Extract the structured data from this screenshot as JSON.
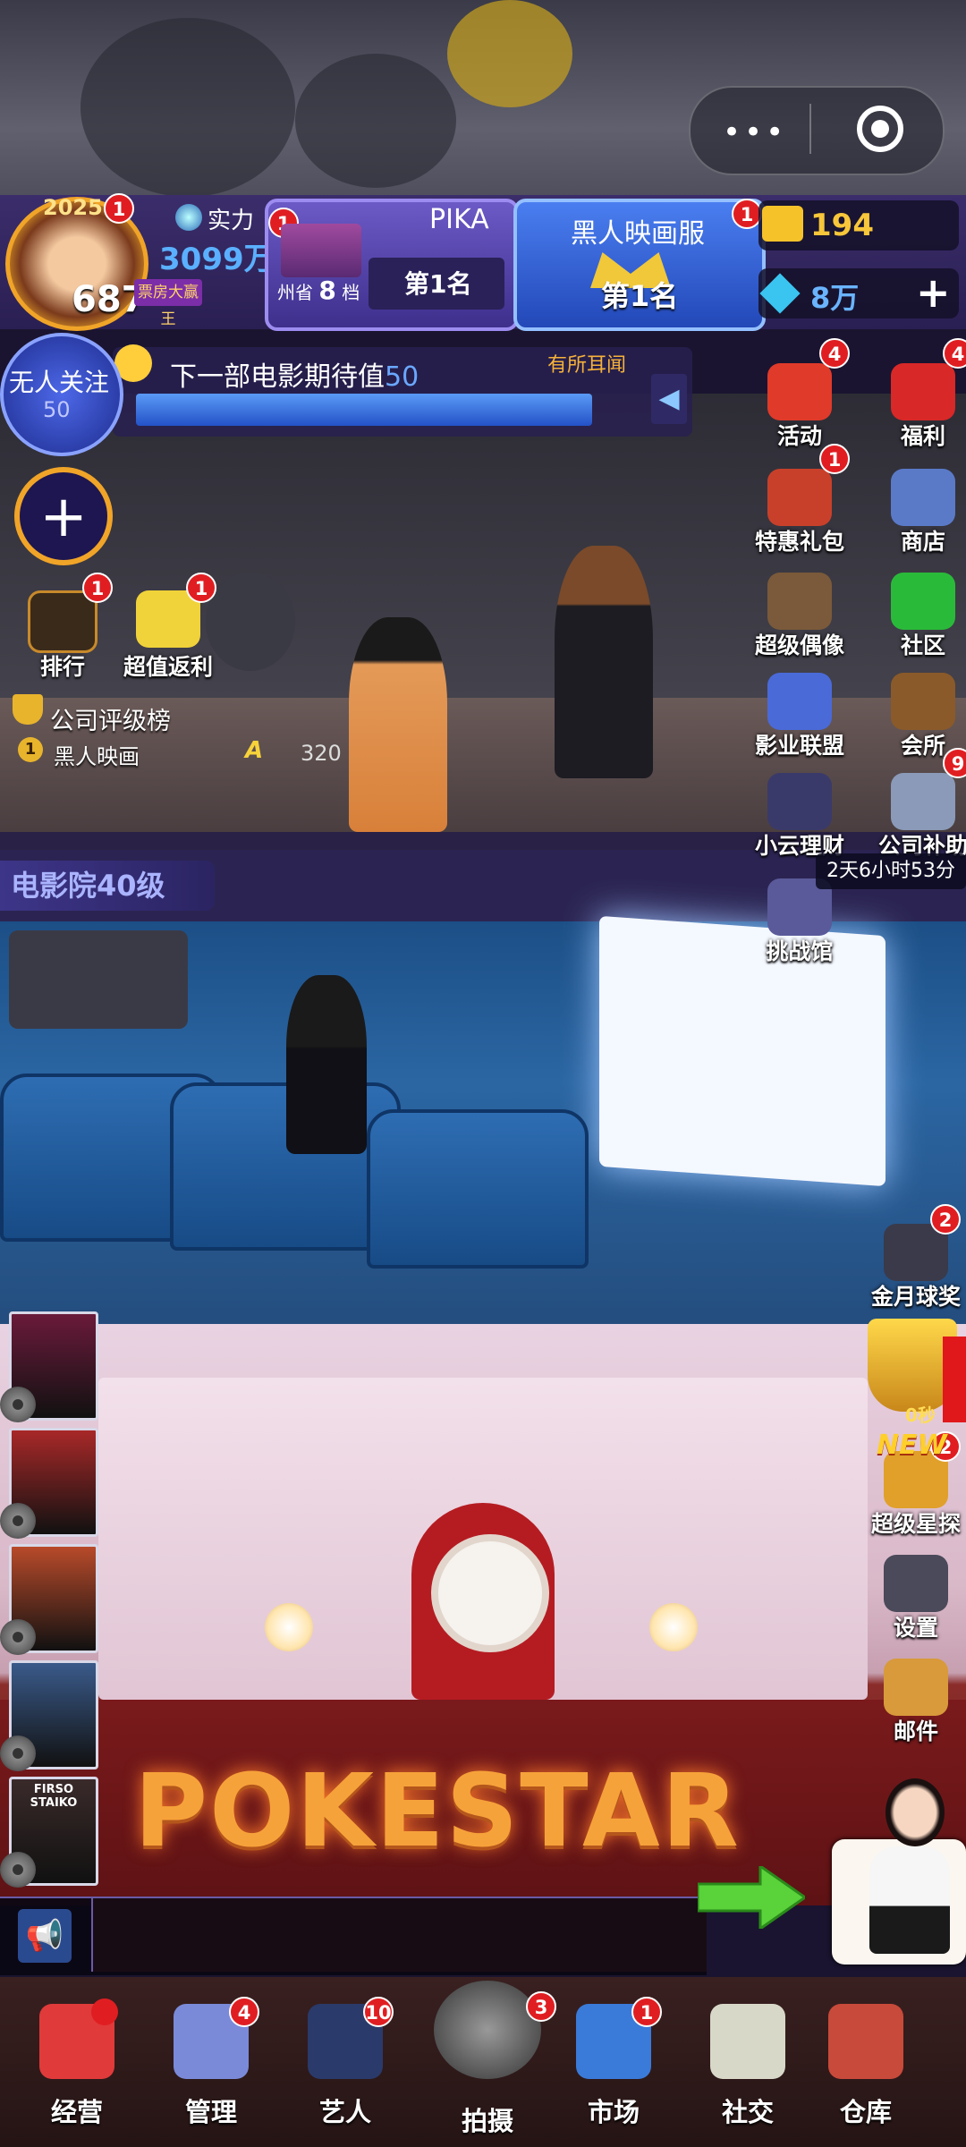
{
  "top_pill": {
    "more_label": "•••",
    "target_label": "◎"
  },
  "player": {
    "year": "2025",
    "level": "687",
    "crown_title": "票房大赢王",
    "power_label": "实力",
    "power_value": "3099万",
    "avatar_badge": "1"
  },
  "rank_card": {
    "name": "PIKA",
    "state": "州省",
    "tier_num": "8",
    "tier_unit": "档",
    "rank": "第1名",
    "badge": "1"
  },
  "server_card": {
    "name": "黑人映画服",
    "rank": "第1名",
    "badge": "1"
  },
  "currency": {
    "gold": "194",
    "gems": "8万",
    "gold_icon": "ticket-icon",
    "gem_icon": "diamond-icon",
    "add_label": "+"
  },
  "attention": {
    "label": "无人关注",
    "value": "50"
  },
  "expectation": {
    "label": "下一部电影期待值",
    "value": "50",
    "progress_percent": 100,
    "tag": "有所耳闻",
    "arrow": "◀"
  },
  "left_buttons": {
    "add": "+",
    "ranking": {
      "label": "排行",
      "badge": "1"
    },
    "rebate": {
      "label": "超值返利",
      "badge": "1"
    }
  },
  "company_rating": {
    "title": "公司评级榜",
    "rank": "1",
    "company": "黑人映画",
    "grade": "A",
    "score": "320"
  },
  "right_buttons": [
    {
      "id": "activity",
      "label": "活动",
      "badge": "4",
      "icon": "gift-box-icon",
      "color": "#e03a2a"
    },
    {
      "id": "welfare",
      "label": "福利",
      "badge": "4",
      "icon": "red-envelope-icon",
      "color": "#d82828"
    },
    {
      "id": "discount",
      "label": "特惠礼包",
      "badge": "1",
      "icon": "gift-pack-icon",
      "color": "#c8402a"
    },
    {
      "id": "shop",
      "label": "商店",
      "badge": "",
      "icon": "shop-icon",
      "color": "#5a7ac8"
    },
    {
      "id": "idol",
      "label": "超级偶像",
      "badge": "",
      "icon": "clapper-icon",
      "color": "#7a5a3a"
    },
    {
      "id": "community",
      "label": "社区",
      "badge": "",
      "icon": "wechat-icon",
      "color": "#2aba3a"
    },
    {
      "id": "alliance",
      "label": "影业联盟",
      "badge": "",
      "icon": "building-icon",
      "color": "#4a6ad8"
    },
    {
      "id": "club",
      "label": "会所",
      "badge": "",
      "icon": "house-icon",
      "color": "#8a5a2a"
    },
    {
      "id": "finance",
      "label": "小云理财",
      "badge": "",
      "icon": "safe-icon",
      "color": "#3a3a6a"
    },
    {
      "id": "subsidy",
      "label": "公司补助",
      "badge": "9",
      "icon": "megaphone-icon",
      "color": "#8a9ab8"
    },
    {
      "id": "challenge",
      "label": "挑战馆",
      "badge": "",
      "icon": "arena-icon",
      "color": "#5a5a9a"
    }
  ],
  "subsidy_timer": "2天6小时53分",
  "cinema_level": "电影院40级",
  "lower_right_buttons": [
    {
      "id": "golden-moon",
      "label": "金月球奖",
      "badge": "2",
      "icon": "award-icon",
      "color": "#3a3a4a"
    },
    {
      "id": "star-scout",
      "label": "超级星探",
      "badge": "2",
      "icon": "scout-icon",
      "color": "#e0a02a"
    },
    {
      "id": "settings",
      "label": "设置",
      "badge": "",
      "icon": "gear-icon",
      "color": "#4a4a5a"
    },
    {
      "id": "mail",
      "label": "邮件",
      "badge": "",
      "icon": "envelope-icon",
      "color": "#d89a3a"
    }
  ],
  "trophy_seconds": "0秒",
  "new_tag": "NEW",
  "films": [
    {
      "color": "#6a1a3a"
    },
    {
      "color": "#a82828"
    },
    {
      "color": "#b84a2a"
    },
    {
      "color": "#3a5a8a"
    },
    {
      "caption": "FIRSO STAIKO",
      "color": "#3a2a2a"
    }
  ],
  "lobby_sign": "POKESTAR",
  "chat": {
    "horn_icon": "megaphone-icon",
    "message": ""
  },
  "bottom_nav": [
    {
      "id": "operate",
      "label": "经营",
      "badge": "",
      "dot": true,
      "icon": "popcorn-icon",
      "color": "#e03a3a"
    },
    {
      "id": "manage",
      "label": "管理",
      "badge": "4",
      "dot": false,
      "icon": "puzzle-icon",
      "color": "#7a8ad8"
    },
    {
      "id": "artist",
      "label": "艺人",
      "badge": "10",
      "dot": false,
      "icon": "actor-icon",
      "color": "#2a3a6a"
    },
    {
      "id": "shoot",
      "label": "拍摄",
      "badge": "3",
      "dot": false,
      "icon": "camera-icon",
      "color": "#555"
    },
    {
      "id": "market",
      "label": "市场",
      "badge": "1",
      "dot": false,
      "icon": "chart-icon",
      "color": "#3a7ad8"
    },
    {
      "id": "social",
      "label": "社交",
      "badge": "",
      "dot": false,
      "icon": "coffee-icon",
      "color": "#d8d8c8"
    },
    {
      "id": "storage",
      "label": "仓库",
      "badge": "",
      "dot": false,
      "icon": "warehouse-icon",
      "color": "#c84a3a"
    }
  ]
}
